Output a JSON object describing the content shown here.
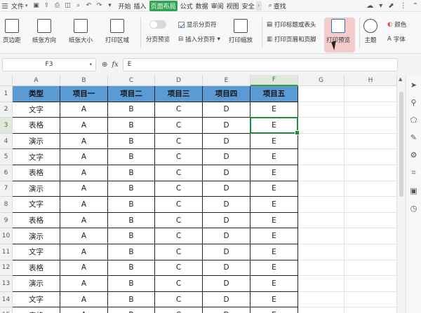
{
  "menubar": {
    "file_label": "文件",
    "tabs": [
      "开始",
      "插入",
      "页面布局",
      "公式",
      "数据",
      "审阅",
      "视图",
      "安全"
    ],
    "active_tab_index": 2,
    "search_label": "查找"
  },
  "ribbon": {
    "margins": "页边距",
    "orientation": "纸张方向",
    "size": "纸张大小",
    "print_area": "打印区域",
    "page_break_preview": "分页预览",
    "show_page_breaks": "显示分页符",
    "insert_page_break": "插入分页符",
    "print_scaling": "打印缩放",
    "print_titles": "打印标题或表头",
    "print_header_footer": "打印页眉和页脚",
    "print_preview": "打印预览",
    "themes": "主题",
    "colors": "颜色",
    "fonts": "字体"
  },
  "formula_bar": {
    "cell_ref": "F3",
    "fx": "fx",
    "value": "E"
  },
  "grid": {
    "columns": [
      "A",
      "B",
      "C",
      "D",
      "E",
      "F",
      "G",
      "H"
    ],
    "selected_column": "F",
    "selected_row": 3,
    "row_numbers": [
      "1",
      "2",
      "3",
      "4",
      "5",
      "6",
      "7",
      "8",
      "9",
      "10",
      "11",
      "12",
      "13",
      "14",
      "15"
    ],
    "headers": [
      "类型",
      "项目一",
      "项目二",
      "项目三",
      "项目四",
      "项目五"
    ],
    "rows": [
      [
        "文字",
        "A",
        "B",
        "C",
        "D",
        "E"
      ],
      [
        "表格",
        "A",
        "B",
        "C",
        "D",
        "E"
      ],
      [
        "演示",
        "A",
        "B",
        "C",
        "D",
        "E"
      ],
      [
        "文字",
        "A",
        "B",
        "C",
        "D",
        "E"
      ],
      [
        "表格",
        "A",
        "B",
        "C",
        "D",
        "E"
      ],
      [
        "演示",
        "A",
        "B",
        "C",
        "D",
        "E"
      ],
      [
        "文字",
        "A",
        "B",
        "C",
        "D",
        "E"
      ],
      [
        "表格",
        "A",
        "B",
        "C",
        "D",
        "E"
      ],
      [
        "演示",
        "A",
        "B",
        "C",
        "D",
        "E"
      ],
      [
        "文字",
        "A",
        "B",
        "C",
        "D",
        "E"
      ],
      [
        "表格",
        "A",
        "B",
        "C",
        "D",
        "E"
      ],
      [
        "演示",
        "A",
        "B",
        "C",
        "D",
        "E"
      ],
      [
        "文字",
        "A",
        "B",
        "C",
        "D",
        "E"
      ],
      [
        "表格",
        "A",
        "B",
        "C",
        "D",
        "E"
      ]
    ]
  },
  "colors": {
    "header_fill": "#5b9bd5",
    "active_tab": "#2da44e",
    "selection": "#1e8a3c"
  }
}
